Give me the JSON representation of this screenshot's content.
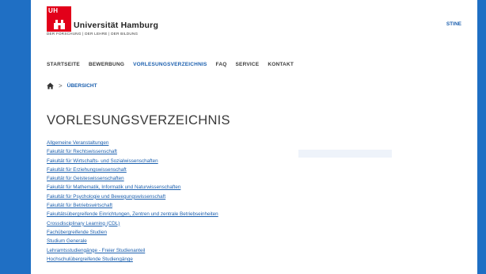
{
  "header": {
    "logo_mark": "UH",
    "logo_name": "Universität Hamburg",
    "logo_tagline": "DER FORSCHUNG | DER LEHRE | DER BILDUNG",
    "stine_label": "STINE"
  },
  "nav": {
    "items": [
      "STARTSEITE",
      "BEWERBUNG",
      "VORLESUNGSVERZEICHNIS",
      "FAQ",
      "SERVICE",
      "KONTAKT"
    ],
    "active_index": 2
  },
  "breadcrumb": {
    "home_icon": "home-icon",
    "current": "ÜBERSICHT"
  },
  "main": {
    "title": "VORLESUNGSVERZEICHNIS",
    "links": [
      "Allgemeine Veranstaltungen",
      "Fakultät für Rechtswissenschaft",
      "Fakultät für Wirtschafts- und Sozialwissenschaften",
      "Fakultät für Erziehungswissenschaft",
      "Fakultät für Geisteswissenschaften",
      "Fakultät für Mathematik, Informatik und Naturwissenschaften",
      "Fakultät für Psychologie und Bewegungswissenschaft",
      "Fakultät für Betriebswirtschaft",
      "Fakultätsübergreifende Einrichtungen, Zentren und zentrale Betriebseinheiten",
      "Crossdisciplinary Learning (CDL)",
      "Fachübergreifende Studien",
      "Studium Generale",
      "Lehramtsstudiengänge - Freier Studienanteil",
      "Hochschulübergreifende Studiengänge"
    ]
  },
  "colors": {
    "background": "#1f6fc4",
    "brand_red": "#e2001a",
    "link_blue": "#1b5fae"
  }
}
